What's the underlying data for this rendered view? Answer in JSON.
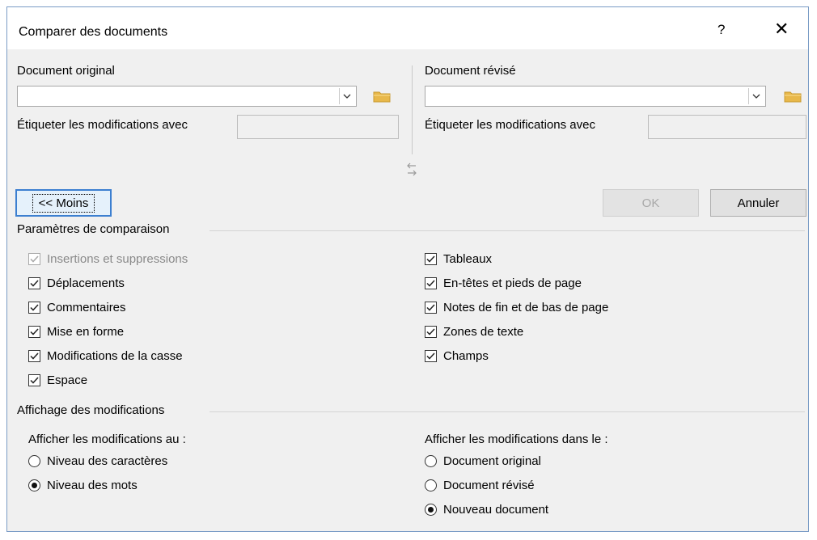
{
  "dialog": {
    "title": "Comparer des documents",
    "help": "?",
    "close": "✕"
  },
  "original": {
    "label": "Document original",
    "value": "",
    "label_changes": "Étiqueter les modifications avec",
    "label_changes_value": ""
  },
  "revised": {
    "label": "Document révisé",
    "value": "",
    "label_changes": "Étiqueter les modifications avec",
    "label_changes_value": ""
  },
  "buttons": {
    "less": "<< Moins",
    "ok": "OK",
    "cancel": "Annuler"
  },
  "comparison": {
    "title": "Paramètres de comparaison",
    "left": [
      {
        "label": "Insertions et suppressions",
        "checked": true,
        "disabled": true
      },
      {
        "label": "Déplacements",
        "checked": true,
        "disabled": false
      },
      {
        "label": "Commentaires",
        "checked": true,
        "disabled": false
      },
      {
        "label": "Mise en forme",
        "checked": true,
        "disabled": false
      },
      {
        "label": "Modifications de la casse",
        "checked": true,
        "disabled": false
      },
      {
        "label": "Espace",
        "checked": true,
        "disabled": false
      }
    ],
    "right": [
      {
        "label": "Tableaux",
        "checked": true
      },
      {
        "label": "En-têtes et pieds de page",
        "checked": true
      },
      {
        "label": "Notes de fin et de bas de page",
        "checked": true
      },
      {
        "label": "Zones de texte",
        "checked": true
      },
      {
        "label": "Champs",
        "checked": true
      }
    ]
  },
  "display": {
    "title": "Affichage des modifications",
    "level_label": "Afficher les modifications au :",
    "level_options": [
      {
        "label": "Niveau des caractères",
        "selected": false
      },
      {
        "label": "Niveau des mots",
        "selected": true
      }
    ],
    "target_label": "Afficher les modifications dans le :",
    "target_options": [
      {
        "label": "Document original",
        "selected": false
      },
      {
        "label": "Document révisé",
        "selected": false
      },
      {
        "label": "Nouveau document",
        "selected": true
      }
    ]
  },
  "colors": {
    "accent": "#3c7fd0",
    "folder": "#e8b84a"
  }
}
